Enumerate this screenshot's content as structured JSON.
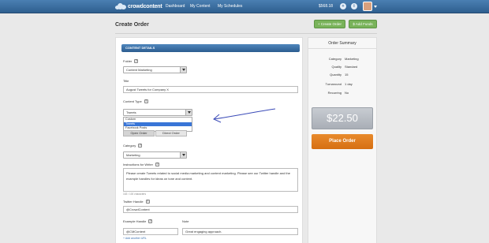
{
  "nav": {
    "logo_text": "crowdcontent",
    "links": [
      "Dashboard",
      "My Content",
      "My Schedules"
    ],
    "balance": "$568.18",
    "plus_icon_glyph": "+",
    "info_icon_glyph": "i"
  },
  "header": {
    "title": "Create Order",
    "create_order": "+ Create Order",
    "add_funds": "$ Add Funds"
  },
  "form": {
    "section_title": "CONTENT DETAILS",
    "help_glyph": "?",
    "folder_label": "Folder",
    "folder_value": "Content Marketing",
    "title_label": "Title",
    "title_value": "August Tweets for Company X",
    "content_type_label": "Content Type",
    "content_type_value": "Tweets",
    "content_type_options": [
      "Custom",
      "Tweets",
      "Facebook Posts"
    ],
    "open_order": "Open Order",
    "direct_order": "Direct Order",
    "category_label": "Category",
    "category_value": "Marketing",
    "instructions_label": "Instructions for Writer",
    "instructions_value": "Please create Tweets related to social media marketing and content marketing. Please see our Twitter handle and the example handles for ideas on tone and content.",
    "char_count": "163 / 100 characters",
    "twitter_label": "Twitter Handle",
    "twitter_value": "@CrowdContent",
    "example_handle_label": "Example Handle",
    "example_handle_value": "@CMContent",
    "note_label": "Note",
    "note_value": "Great engaging approach.",
    "add_link": "+ Add another URL"
  },
  "summary": {
    "title": "Order Summary",
    "rows": [
      {
        "k": "Category",
        "v": "Marketing"
      },
      {
        "k": "Quality",
        "v": "Standard"
      },
      {
        "k": "Quantity",
        "v": "15"
      },
      {
        "k": "Turnaround",
        "v": "1 day"
      },
      {
        "k": "Recurring",
        "v": "No"
      }
    ],
    "price": "$22.50",
    "place_order": "Place Order"
  }
}
